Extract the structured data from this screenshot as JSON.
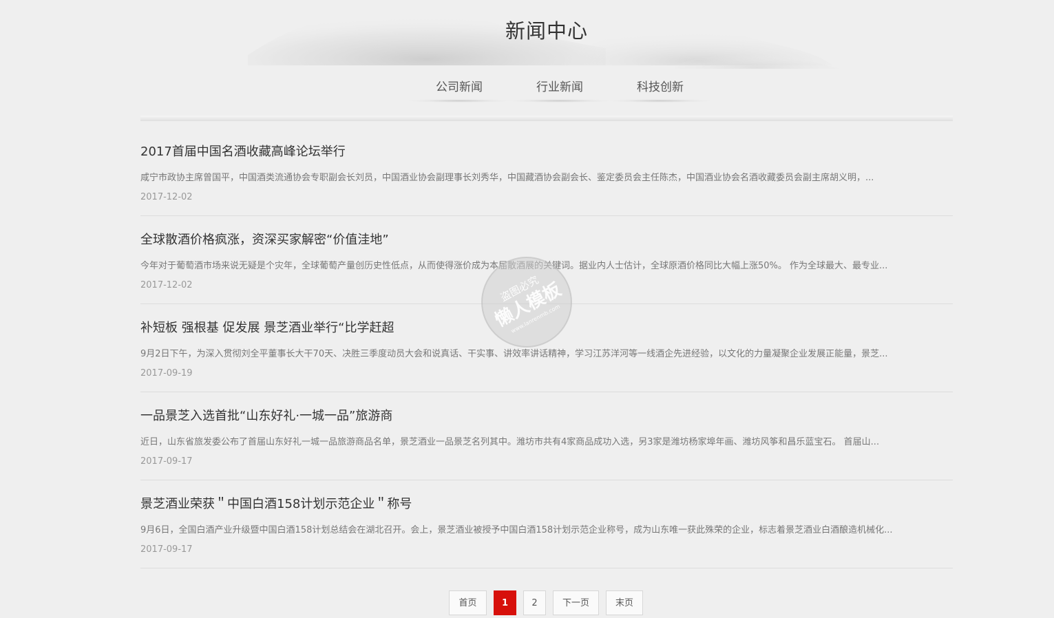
{
  "page": {
    "title": "新闻中心"
  },
  "tabs": [
    {
      "label": "公司新闻"
    },
    {
      "label": "行业新闻"
    },
    {
      "label": "科技创新"
    }
  ],
  "news": [
    {
      "title": "2017首届中国名酒收藏高峰论坛举行",
      "summary": "咸宁市政协主席曾国平，中国酒类流通协会专职副会长刘员，中国酒业协会副理事长刘秀华，中国藏酒协会副会长、鉴定委员会主任陈杰，中国酒业协会名酒收藏委员会副主席胡义明，...",
      "date": "2017-12-02"
    },
    {
      "title": "全球散酒价格疯涨，资深买家解密“价值洼地”",
      "summary": "今年对于葡萄酒市场来说无疑是个灾年，全球葡萄产量创历史性低点，从而使得涨价成为本届散酒展的关键词。据业内人士估计，全球原酒价格同比大幅上涨50%。 作为全球最大、最专业...",
      "date": "2017-12-02"
    },
    {
      "title": "补短板 强根基 促发展 景芝酒业举行“比学赶超",
      "summary": "9月2日下午，为深入贯彻刘全平董事长大干70天、决胜三季度动员大会和说真话、干实事、讲效率讲话精神，学习江苏洋河等一线酒企先进经验，以文化的力量凝聚企业发展正能量，景芝...",
      "date": "2017-09-19"
    },
    {
      "title": "一品景芝入选首批“山东好礼·一城一品”旅游商",
      "summary": "近日，山东省旅发委公布了首届山东好礼一城一品旅游商品名单，景芝酒业一品景芝名列其中。潍坊市共有4家商品成功入选，另3家是潍坊杨家埠年画、潍坊风筝和昌乐蓝宝石。 首届山...",
      "date": "2017-09-17"
    },
    {
      "title": "景芝酒业荣获＂中国白酒158计划示范企业＂称号",
      "summary": "9月6日，全国白酒产业升级暨中国白酒158计划总结会在湖北召开。会上，景芝酒业被授予中国白酒158计划示范企业称号，成为山东唯一获此殊荣的企业，标志着景芝酒业白酒酿造机械化...",
      "date": "2017-09-17"
    }
  ],
  "pagination": {
    "first": "首页",
    "pages": [
      "1",
      "2"
    ],
    "current": "1",
    "next": "下一页",
    "last": "末页"
  },
  "watermark": {
    "line1": "盗图必究",
    "line2": "懒人模板",
    "line3": "www.lanrenmb.com"
  },
  "colors": {
    "accent": "#d7100b",
    "background": "#efefef"
  }
}
